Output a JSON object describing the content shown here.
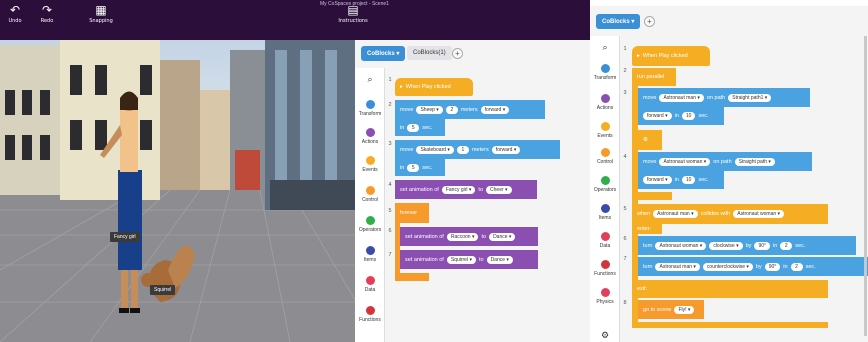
{
  "toolbar": {
    "undo": "Undo",
    "redo": "Redo",
    "snapping": "Snapping",
    "instructions": "Instructions",
    "project_title": "My CoSpaces project - Scene1"
  },
  "scene": {
    "labels": {
      "girl": "Fancy girl",
      "squirrel": "Squirrel"
    }
  },
  "editor_left": {
    "tab_active": "CoBlocks",
    "tab_other": "CoBlocks(1)",
    "plus": "+",
    "categories": [
      "Transform",
      "Actions",
      "Events",
      "Control",
      "Operators",
      "Items",
      "Data",
      "Functions"
    ],
    "lines": [
      "1",
      "2",
      "3",
      "4",
      "5",
      "6",
      "7"
    ],
    "blocks": {
      "when_play": "When Play clicked",
      "move1": {
        "verb": "move",
        "obj": "Sheep",
        "num": "2",
        "unit": "meters",
        "dir": "forward",
        "in": "in",
        "time": "5",
        "sec": "sec."
      },
      "move2": {
        "verb": "move",
        "obj": "Skateboard",
        "num": "1",
        "unit": "meters",
        "dir": "forward",
        "in": "in",
        "time": "5",
        "sec": "sec."
      },
      "anim1": {
        "txt": "set animation of",
        "obj": "Fancy girl",
        "to": "to",
        "anim": "Cheer"
      },
      "forever": "forever",
      "anim2": {
        "txt": "set animation of",
        "obj": "Raccoon",
        "to": "to",
        "anim": "Dance"
      },
      "anim3": {
        "txt": "set animation of",
        "obj": "Squirrel",
        "to": "to",
        "anim": "Dance"
      }
    }
  },
  "editor_right": {
    "tab_active": "CoBlocks",
    "plus": "+",
    "categories": [
      "Transform",
      "Actions",
      "Events",
      "Control",
      "Operators",
      "Items",
      "Data",
      "Functions",
      "Physics"
    ],
    "lines": [
      "1",
      "2",
      "3",
      "4",
      "5",
      "6",
      "7",
      "8"
    ],
    "blocks": {
      "when_play": "When Play clicked",
      "run_parallel": "run parallel",
      "move_a": {
        "verb": "move",
        "obj": "Astronaut man",
        "on": "on path",
        "path": "Straight path1",
        "dir": "forward",
        "in": "in",
        "time": "10",
        "sec": "sec."
      },
      "move_b": {
        "verb": "move",
        "obj": "Astronaut woman",
        "on": "on path",
        "path": "Straight path",
        "dir": "forward",
        "in": "in",
        "time": "10",
        "sec": "sec."
      },
      "when": {
        "when": "when",
        "obj": "Astronaut man",
        "collides": "collides with",
        "obj2": "Astronaut woman"
      },
      "enter": "enter:",
      "turn1": {
        "verb": "turn",
        "obj": "Astronaut woman",
        "dir": "clockwise",
        "by": "by",
        "deg": "90°",
        "in": "in",
        "time": "2",
        "sec": "sec."
      },
      "turn2": {
        "verb": "turn",
        "obj": "Astronaut man",
        "dir": "counterclockwise",
        "by": "by",
        "deg": "90°",
        "in": "in",
        "time": "2",
        "sec": "sec."
      },
      "exit": "exit:",
      "goto": {
        "txt": "go to scene",
        "scene": "Fly!"
      }
    }
  },
  "colors": {
    "topbar": "#2b0f3a",
    "accent": "#3a8fd6",
    "event": "#f5ae24",
    "motion": "#4aa3e0",
    "looks": "#8a4fb0"
  }
}
